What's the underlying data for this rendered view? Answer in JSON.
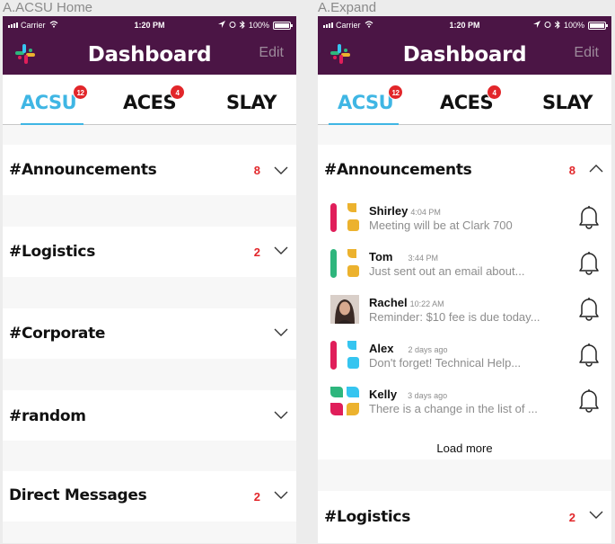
{
  "screens": [
    {
      "label": "A.ACSU Home",
      "status": {
        "carrier": "Carrier",
        "time": "1:20 PM",
        "battery": "100%"
      },
      "nav": {
        "title": "Dashboard",
        "edit": "Edit"
      },
      "tabs": [
        {
          "label": "ACSU",
          "badge": "12",
          "active": true
        },
        {
          "label": "ACES",
          "badge": "4"
        },
        {
          "label": "SLAY",
          "badge": ""
        }
      ],
      "channels": [
        {
          "name": "#Announcements",
          "count": "8"
        },
        {
          "name": "#Logistics",
          "count": "2"
        },
        {
          "name": "#Corporate",
          "count": ""
        },
        {
          "name": "#random",
          "count": ""
        },
        {
          "name": "Direct Messages",
          "count": "2"
        }
      ]
    },
    {
      "label": "A.Expand",
      "status": {
        "carrier": "Carrier",
        "time": "1:20 PM",
        "battery": "100%"
      },
      "nav": {
        "title": "Dashboard",
        "edit": "Edit"
      },
      "tabs": [
        {
          "label": "ACSU",
          "badge": "12",
          "active": true
        },
        {
          "label": "ACES",
          "badge": "4"
        },
        {
          "label": "SLAY",
          "badge": ""
        }
      ],
      "expanded": {
        "name": "#Announcements",
        "count": "8",
        "messages": [
          {
            "name": "Shirley",
            "time": "4:04 PM",
            "preview": "Meeting will be at Clark 700",
            "avatar": "slack-red-yellow"
          },
          {
            "name": "Tom",
            "time": "3:44 PM",
            "preview": "Just sent out an email about...",
            "avatar": "slack-green-yellow"
          },
          {
            "name": "Rachel",
            "time": "10:22 AM",
            "preview": "Reminder: $10 fee is due today...",
            "avatar": "photo"
          },
          {
            "name": "Alex",
            "time": "2 days ago",
            "preview": "Don't forget! Technical Help...",
            "avatar": "slack-red-blue"
          },
          {
            "name": "Kelly",
            "time": "3 days ago",
            "preview": "There is a change in the list of ...",
            "avatar": "slack-full"
          }
        ],
        "load_more": "Load more"
      },
      "channels": [
        {
          "name": "#Logistics",
          "count": "2"
        }
      ]
    }
  ],
  "colors": {
    "header": "#4b1545",
    "accent": "#3fb6e4",
    "alert": "#e2262a"
  }
}
